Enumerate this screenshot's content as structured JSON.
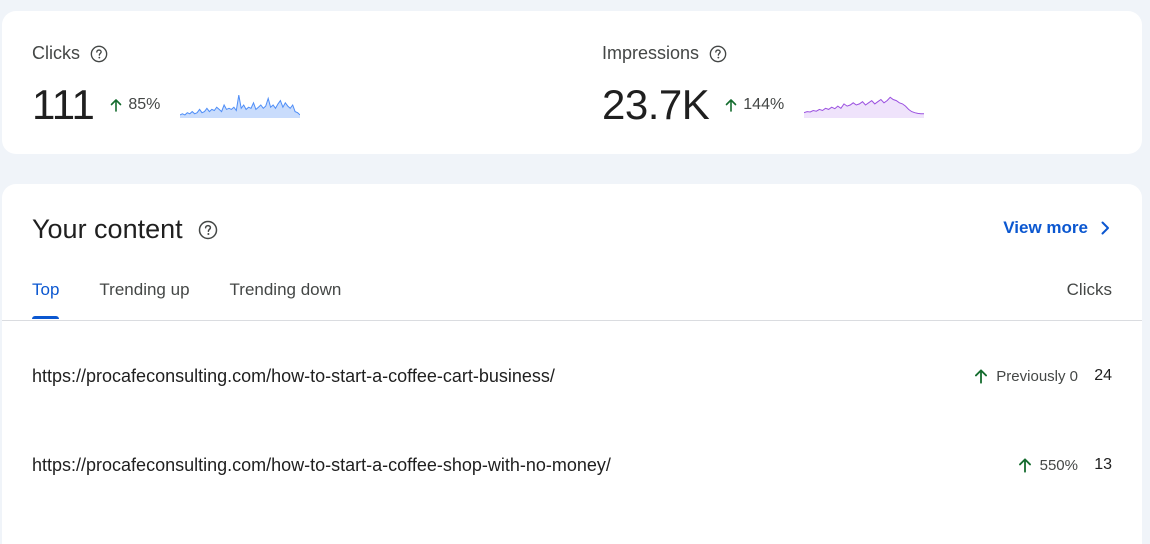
{
  "metrics": {
    "clicks": {
      "label": "Clicks",
      "value": "111",
      "change": "85%",
      "line_color": "#4f8ef7",
      "fill_color": "#c9dcfc"
    },
    "impressions": {
      "label": "Impressions",
      "value": "23.7K",
      "change": "144%",
      "line_color": "#9b51e0",
      "fill_color": "#efe3fb"
    }
  },
  "content": {
    "title": "Your content",
    "view_more": "View more",
    "tabs": [
      {
        "label": "Top",
        "active": true
      },
      {
        "label": "Trending up",
        "active": false
      },
      {
        "label": "Trending down",
        "active": false
      }
    ],
    "column_header": "Clicks",
    "rows": [
      {
        "url": "https://procafeconsulting.com/how-to-start-a-coffee-cart-business/",
        "change": "Previously 0",
        "value": "24"
      },
      {
        "url": "https://procafeconsulting.com/how-to-start-a-coffee-shop-with-no-money/",
        "change": "550%",
        "value": "13"
      }
    ]
  },
  "colors": {
    "accent": "#0b57d0",
    "up_arrow": "#146c2e"
  },
  "icons": {
    "help": "help-circle-icon",
    "trend_up": "arrow-up-icon",
    "chevron": "chevron-right-icon"
  }
}
